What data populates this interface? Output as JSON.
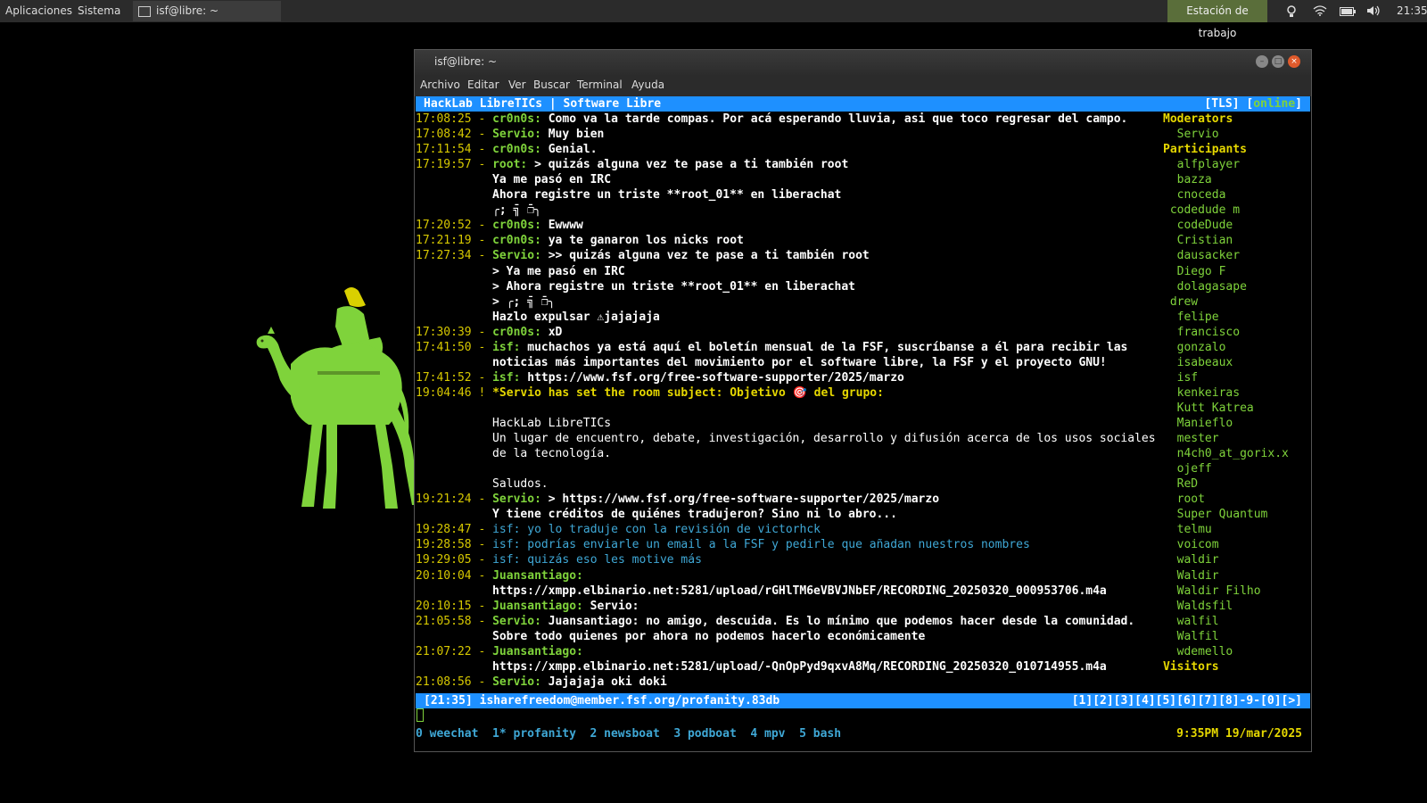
{
  "panel": {
    "apps": "Aplicaciones",
    "system": "Sistema",
    "task": "isf@libre: ~",
    "workspace": "Estación de trabajo",
    "time": "21:35"
  },
  "window": {
    "title": "isf@libre: ~",
    "menu": [
      "Archivo",
      "Editar",
      "Ver",
      "Buscar",
      "Terminal",
      "Ayuda"
    ]
  },
  "topbar": {
    "room": "HackLab LibreTICs | Software Libre",
    "tls": "[TLS] [",
    "online": "online",
    "close": "]"
  },
  "messages": [
    {
      "t": "17:08:25",
      "sep": " - ",
      "nick": "cr0n0s:",
      "text": " Como va la tarde compas. Por acá esperando lluvia, asi que toco regresar del campo.",
      "style": "g"
    },
    {
      "t": "17:08:42",
      "sep": " - ",
      "nick": "Servio:",
      "text": " Muy bien",
      "style": "g"
    },
    {
      "t": "17:11:54",
      "sep": " - ",
      "nick": "cr0n0s:",
      "text": " Genial.",
      "style": "g"
    },
    {
      "t": "17:19:57",
      "sep": " - ",
      "nick": "root:",
      "text": " > quizás alguna vez te pase a ti también root",
      "style": "g"
    },
    {
      "t": "",
      "sep": "",
      "nick": "",
      "text": "Ya me pasó en IRC",
      "style": "c"
    },
    {
      "t": "",
      "sep": "",
      "nick": "",
      "text": "Ahora registre un triste **root_01** en liberachat",
      "style": "c"
    },
    {
      "t": "",
      "sep": "",
      "nick": "",
      "text": "╭; ̄╗ ̄❐╮",
      "style": "c"
    },
    {
      "t": "17:20:52",
      "sep": " - ",
      "nick": "cr0n0s:",
      "text": " Ewwww",
      "style": "g"
    },
    {
      "t": "17:21:19",
      "sep": " - ",
      "nick": "cr0n0s:",
      "text": " ya te ganaron los nicks root",
      "style": "g"
    },
    {
      "t": "17:27:34",
      "sep": " - ",
      "nick": "Servio:",
      "text": " >> quizás alguna vez te pase a ti también root",
      "style": "g"
    },
    {
      "t": "",
      "sep": "",
      "nick": "",
      "text": "> Ya me pasó en IRC",
      "style": "c"
    },
    {
      "t": "",
      "sep": "",
      "nick": "",
      "text": "> Ahora registre un triste **root_01** en liberachat",
      "style": "c"
    },
    {
      "t": "",
      "sep": "",
      "nick": "",
      "text": "> ╭; ̄╗ ̄❐╮",
      "style": "c"
    },
    {
      "t": "",
      "sep": "",
      "nick": "",
      "text": "Hazlo expulsar ⚠jajajaja",
      "style": "c"
    },
    {
      "t": "17:30:39",
      "sep": " - ",
      "nick": "cr0n0s:",
      "text": " xD",
      "style": "g"
    },
    {
      "t": "17:41:50",
      "sep": " - ",
      "nick": "isf:",
      "text": " muchachos ya está aquí el boletín mensual de la FSF, suscríbanse a él para recibir las",
      "style": "g"
    },
    {
      "t": "",
      "sep": "",
      "nick": "",
      "text": "noticias más importantes del movimiento por el software libre, la FSF y el proyecto GNU!",
      "style": "c"
    },
    {
      "t": "17:41:52",
      "sep": " - ",
      "nick": "isf:",
      "text": " https://www.fsf.org/free-software-supporter/2025/marzo",
      "style": "g"
    },
    {
      "t": "19:04:46",
      "sep": " ! ",
      "nick": "",
      "text": "*Servio has set the room subject: Objetivo 🎯 del grupo:",
      "style": "y"
    },
    {
      "t": "",
      "sep": "",
      "nick": "",
      "text": "",
      "style": "c"
    },
    {
      "t": "",
      "sep": "",
      "nick": "",
      "text": "HackLab LibreTICs",
      "style": "n"
    },
    {
      "t": "",
      "sep": "",
      "nick": "",
      "text": "Un lugar de encuentro, debate, investigación, desarrollo y difusión acerca de los usos sociales",
      "style": "n"
    },
    {
      "t": "",
      "sep": "",
      "nick": "",
      "text": "de la tecnología.",
      "style": "n"
    },
    {
      "t": "",
      "sep": "",
      "nick": "",
      "text": "",
      "style": "c"
    },
    {
      "t": "",
      "sep": "",
      "nick": "",
      "text": "Saludos.",
      "style": "n"
    },
    {
      "t": "19:21:24",
      "sep": " - ",
      "nick": "Servio:",
      "text": " > https://www.fsf.org/free-software-supporter/2025/marzo",
      "style": "g"
    },
    {
      "t": "",
      "sep": "",
      "nick": "",
      "text": "Y tiene créditos de quiénes tradujeron? Sino ni lo abro...",
      "style": "c"
    },
    {
      "t": "19:28:47",
      "sep": " - ",
      "nick": "isf:",
      "text": " yo lo traduje con la revisión de victorhck",
      "style": "b"
    },
    {
      "t": "19:28:58",
      "sep": " - ",
      "nick": "isf:",
      "text": " podrías enviarle un email a la FSF y pedirle que añadan nuestros nombres",
      "style": "b"
    },
    {
      "t": "19:29:05",
      "sep": " - ",
      "nick": "isf:",
      "text": " quizás eso les motive más",
      "style": "b"
    },
    {
      "t": "20:10:04",
      "sep": " - ",
      "nick": "Juansantiago:",
      "text": "",
      "style": "g"
    },
    {
      "t": "",
      "sep": "",
      "nick": "",
      "text": "https://xmpp.elbinario.net:5281/upload/rGHlTM6eVBVJNbEF/RECORDING_20250320_000953706.m4a",
      "style": "c"
    },
    {
      "t": "20:10:15",
      "sep": " - ",
      "nick": "Juansantiago:",
      "text": " Servio:",
      "style": "g"
    },
    {
      "t": "21:05:58",
      "sep": " - ",
      "nick": "Servio:",
      "text": " Juansantiago: no amigo, descuida. Es lo mínimo que podemos hacer desde la comunidad.",
      "style": "g"
    },
    {
      "t": "",
      "sep": "",
      "nick": "",
      "text": "Sobre todo quienes por ahora no podemos hacerlo económicamente",
      "style": "c"
    },
    {
      "t": "21:07:22",
      "sep": " - ",
      "nick": "Juansantiago:",
      "text": "",
      "style": "g"
    },
    {
      "t": "",
      "sep": "",
      "nick": "",
      "text": "https://xmpp.elbinario.net:5281/upload/-QnOpPyd9qxvA8Mq/RECORDING_20250320_010714955.m4a",
      "style": "c"
    },
    {
      "t": "21:08:56",
      "sep": " - ",
      "nick": "Servio:",
      "text": " Jajajaja oki doki",
      "style": "g"
    }
  ],
  "roster": [
    {
      "name": "Moderators",
      "head": true,
      "indent": 0
    },
    {
      "name": "Servio",
      "head": false,
      "indent": 2
    },
    {
      "name": "Participants",
      "head": true,
      "indent": 0
    },
    {
      "name": "alfplayer",
      "head": false,
      "indent": 2
    },
    {
      "name": "bazza",
      "head": false,
      "indent": 2
    },
    {
      "name": "cnoceda",
      "head": false,
      "indent": 2
    },
    {
      "name": "codedude m",
      "head": false,
      "indent": 1
    },
    {
      "name": "codeDude",
      "head": false,
      "indent": 2
    },
    {
      "name": "Cristian",
      "head": false,
      "indent": 2
    },
    {
      "name": "dausacker",
      "head": false,
      "indent": 2
    },
    {
      "name": "Diego F",
      "head": false,
      "indent": 2
    },
    {
      "name": "dolagasape",
      "head": false,
      "indent": 2
    },
    {
      "name": "drew",
      "head": false,
      "indent": 1
    },
    {
      "name": "felipe",
      "head": false,
      "indent": 2
    },
    {
      "name": "francisco",
      "head": false,
      "indent": 2
    },
    {
      "name": "gonzalo",
      "head": false,
      "indent": 2
    },
    {
      "name": "isabeaux",
      "head": false,
      "indent": 2
    },
    {
      "name": "isf",
      "head": false,
      "indent": 2
    },
    {
      "name": "kenkeiras",
      "head": false,
      "indent": 2
    },
    {
      "name": "Kutt Katrea",
      "head": false,
      "indent": 2
    },
    {
      "name": "Manieflo",
      "head": false,
      "indent": 2
    },
    {
      "name": "mester",
      "head": false,
      "indent": 2
    },
    {
      "name": "n4ch0_at_gorix.x",
      "head": false,
      "indent": 2
    },
    {
      "name": "ojeff",
      "head": false,
      "indent": 2
    },
    {
      "name": "ReD",
      "head": false,
      "indent": 2
    },
    {
      "name": "root",
      "head": false,
      "indent": 2
    },
    {
      "name": "Super Quantum",
      "head": false,
      "indent": 2
    },
    {
      "name": "telmu",
      "head": false,
      "indent": 2
    },
    {
      "name": "voicom",
      "head": false,
      "indent": 2
    },
    {
      "name": "waldir",
      "head": false,
      "indent": 2
    },
    {
      "name": "Waldir",
      "head": false,
      "indent": 2
    },
    {
      "name": "Waldir Filho",
      "head": false,
      "indent": 2
    },
    {
      "name": "Waldsfil",
      "head": false,
      "indent": 2
    },
    {
      "name": "walfil",
      "head": false,
      "indent": 2
    },
    {
      "name": "Walfil",
      "head": false,
      "indent": 2
    },
    {
      "name": "wdemello",
      "head": false,
      "indent": 2
    },
    {
      "name": "Visitors",
      "head": true,
      "indent": 0
    }
  ],
  "statusbar": {
    "left": "[21:35] isharefreedom@member.fsf.org/profanity.83db",
    "tabs": "[1][2][3][4][5][6][7][8]-9-[0][>]"
  },
  "tmux": {
    "windows": [
      "0 weechat",
      "1* profanity",
      "2 newsboat",
      "3 podboat",
      "4 mpv",
      "5 bash"
    ],
    "clock": "9:35PM  19/mar/2025"
  },
  "colors": {
    "accent": "#1e90ff",
    "nick": "#7fd33b",
    "timestamp": "#d6c800",
    "self": "#3fa8d6",
    "panel": "#2b2b2b"
  }
}
